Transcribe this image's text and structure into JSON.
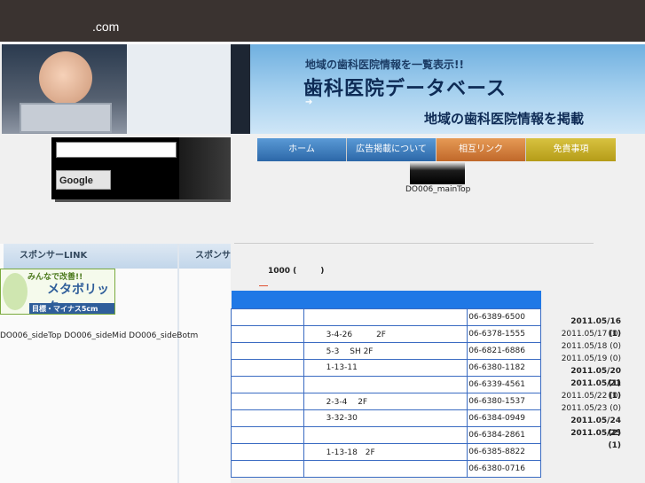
{
  "header": {
    "domain": ".com"
  },
  "banner": {
    "subtitle": "地域の歯科医院情報を一覧表示!!",
    "title": "歯科医院データベース",
    "tagline": "地域の歯科医院情報を掲載",
    "arrow": "➔"
  },
  "search": {
    "button": "Google",
    "query": ""
  },
  "nav": [
    "ホーム",
    "広告掲載について",
    "相互リンク",
    "免責事項"
  ],
  "main_top_label": "DO006_mainTop",
  "sidebar": {
    "tab1": "スポンサーLINK",
    "tab2": "スポンサー",
    "ad": {
      "top": "みんなで改善!!",
      "main": "メタボリック",
      "bottom": "目標・マイナス5cm"
    },
    "labels": "DO006_sideTop DO006_sideMid DO006_sideBotm"
  },
  "count_text": "1000 (　　　)",
  "table": [
    {
      "name": "",
      "address": "",
      "phone": "06-6389-6500"
    },
    {
      "name": "",
      "address": "3-4-26　　　2F",
      "phone": "06-6378-1555"
    },
    {
      "name": "",
      "address": "5-3　 SH 2F",
      "phone": "06-6821-6886"
    },
    {
      "name": "",
      "address": "1-13-11",
      "phone": "06-6380-1182"
    },
    {
      "name": "",
      "address": "",
      "phone": "06-6339-4561"
    },
    {
      "name": "",
      "address": "2-3-4　 2F",
      "phone": "06-6380-1537"
    },
    {
      "name": "",
      "address": "3-32-30",
      "phone": "06-6384-0949"
    },
    {
      "name": "",
      "address": "",
      "phone": "06-6384-2861"
    },
    {
      "name": "",
      "address": "1-13-18　2F",
      "phone": "06-6385-8822"
    },
    {
      "name": "",
      "address": "",
      "phone": "06-6380-0716"
    }
  ],
  "dates": [
    {
      "text": "2011.05/16 (1)",
      "bold": true
    },
    {
      "text": "2011.05/17 (0)",
      "bold": false
    },
    {
      "text": "2011.05/18 (0)",
      "bold": false
    },
    {
      "text": "2011.05/19 (0)",
      "bold": false
    },
    {
      "text": "2011.05/20 (1)",
      "bold": true
    },
    {
      "text": "2011.05/21 (1)",
      "bold": true
    },
    {
      "text": "2011.05/22 (0)",
      "bold": false
    },
    {
      "text": "2011.05/23 (0)",
      "bold": false
    },
    {
      "text": "2011.05/24 (2)",
      "bold": true
    },
    {
      "text": "2011.05/25 (1)",
      "bold": true
    }
  ],
  "colors": {
    "topbar": "#3a3330",
    "nav_blue": "#2c67a8",
    "nav_orange": "#c0682a",
    "nav_yellow": "#b59c18",
    "table_header": "#1f78e6"
  }
}
